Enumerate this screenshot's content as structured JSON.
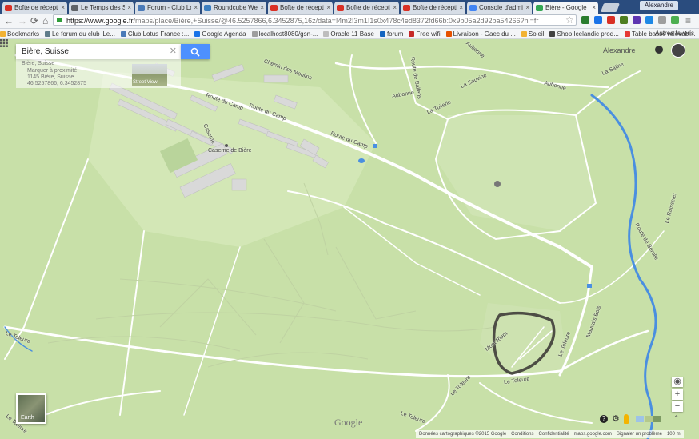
{
  "browser": {
    "tabs": [
      {
        "title": "Boîte de réception",
        "color": "#d93025",
        "active": false
      },
      {
        "title": "Le Temps des Serpe",
        "color": "#5f6368",
        "active": false
      },
      {
        "title": "Forum - Club Lotus",
        "color": "#4a7ab8",
        "active": false
      },
      {
        "title": "Roundcube Webmail",
        "color": "#3c7ebf",
        "active": false
      },
      {
        "title": "Boîte de réception",
        "color": "#d93025",
        "active": false
      },
      {
        "title": "Boîte de réception",
        "color": "#d93025",
        "active": false
      },
      {
        "title": "Boîte de réception",
        "color": "#d93025",
        "active": false
      },
      {
        "title": "Console d'administr",
        "color": "#4285f4",
        "active": false
      },
      {
        "title": "Bière - Google Maps",
        "color": "#34a853",
        "active": true
      }
    ],
    "user_badge": "Alexandre",
    "url_host": "https://www.google.fr",
    "url_path": "/maps/place/Bière,+Suisse/@46.5257866,6.3452875,16z/data=!4m2!3m1!1s0x478c4ed8372fd66b:0x9b05a2d92ba54266?hl=fr",
    "extension_colors": [
      "#2a7d2e",
      "#1a73e8",
      "#d93025",
      "#4e7e20",
      "#5e35b1",
      "#1e88e5",
      "#9e9e9e",
      "#4caf50"
    ],
    "bookmarks": [
      {
        "label": "Bookmarks",
        "color": "#f2b233"
      },
      {
        "label": "Le forum du club 'Le...",
        "color": "#607d8b"
      },
      {
        "label": "Club Lotus France :...",
        "color": "#4a7ab8"
      },
      {
        "label": "Google Agenda",
        "color": "#1a73e8"
      },
      {
        "label": "localhost8080/gsn-...",
        "color": "#9e9e9e"
      },
      {
        "label": "Oracle 11 Base",
        "color": "#bdbdbd"
      },
      {
        "label": "forum",
        "color": "#1565c0"
      },
      {
        "label": "Free wifi",
        "color": "#c62828"
      },
      {
        "label": "Livraison - Gaec du ...",
        "color": "#e65100"
      },
      {
        "label": "Soleil",
        "color": "#f2b233"
      },
      {
        "label": "Shop Icelandic prod...",
        "color": "#424242"
      },
      {
        "label": "Table basse relevabl...",
        "color": "#e53935"
      },
      {
        "label": "20x50",
        "color": "#d81b60"
      }
    ],
    "bookmarks_other": "Autres favoris"
  },
  "search": {
    "query": "Bière, Suisse",
    "card_title": "Bière, Suisse",
    "card_subtitle": "Marquer à proximité",
    "card_address": "1145 Bière, Suisse",
    "card_coords": "46.5257866, 6.3452875",
    "street_view_label": "Street View"
  },
  "account": {
    "name": "Alexandre"
  },
  "map_labels": {
    "route_camp_1": "Route du Camp",
    "route_camp_2": "Route du Camp",
    "route_camp_3": "Route du Camp",
    "chemin_moulins": "Chemin des Moulins",
    "caserne_street": "Caserne",
    "caserne": "Caserne de Bière",
    "aubonne_1": "Aubonne",
    "aubonne_2": "Aubonne",
    "aubonne_3": "Aubonne",
    "la_sauvine": "La Sauvine",
    "la_tuilerie": "La Tuilerie",
    "la_saline": "La Saline",
    "le_toleure_1": "Le Toleure",
    "le_toleure_2": "Le Toleure",
    "le_toleure_3": "Le Toleure",
    "le_toleure_4": "Le Toleure",
    "le_toleure_5": "Le Toleure",
    "le_toleure_6": "Le Toleure",
    "le_ruisselet": "Le Ruisselet",
    "route_berolle": "Route de Berolle",
    "mauvais_pas": "Mauvais Bois",
    "route_ballens": "Route de Ballens",
    "mont_riant": "Mont Riant"
  },
  "earth_label": "Earth",
  "google_logo": "Google",
  "zoom": {
    "in": "+",
    "out": "−"
  },
  "footer": {
    "data": "Données cartographiques ©2015 Google",
    "terms": "Conditions",
    "privacy": "Confidentialité",
    "site": "maps.google.com",
    "report": "Signaler un problème",
    "scale": "100 m"
  }
}
